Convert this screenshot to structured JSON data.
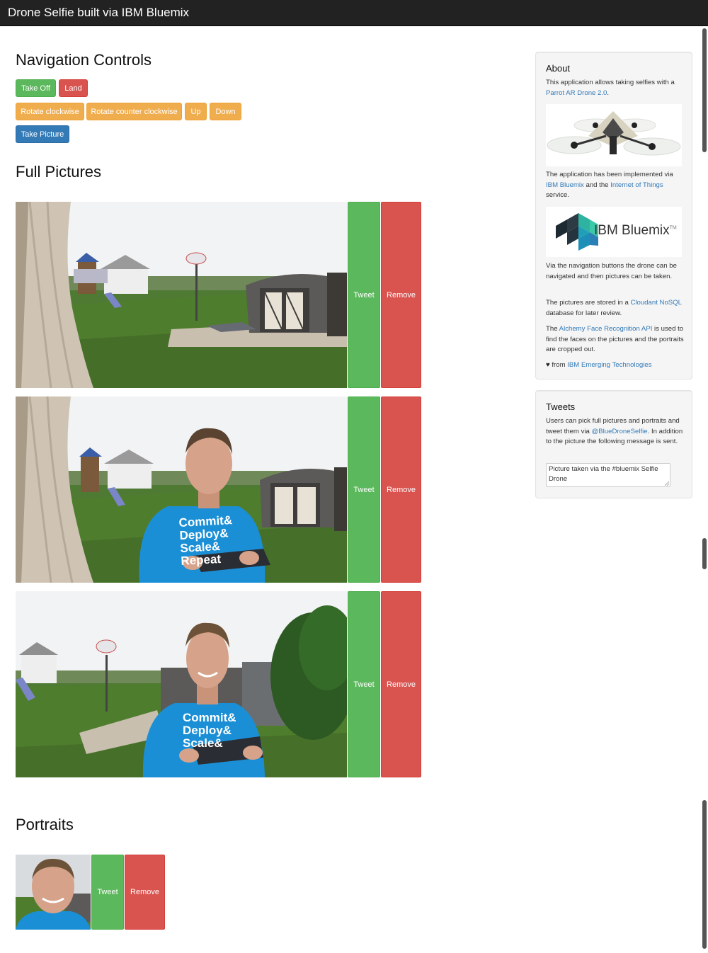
{
  "navbar": {
    "brand": "Drone Selfie built via IBM Bluemix"
  },
  "navigation": {
    "title": "Navigation Controls",
    "buttons": {
      "take_off": "Take Off",
      "land": "Land",
      "rotate_cw": "Rotate clockwise",
      "rotate_ccw": "Rotate counter clockwise",
      "up": "Up",
      "down": "Down",
      "take_picture": "Take Picture"
    }
  },
  "full_pictures": {
    "title": "Full Pictures",
    "items": [
      {
        "tweet": "Tweet",
        "remove": "Remove"
      },
      {
        "tweet": "Tweet",
        "remove": "Remove"
      },
      {
        "tweet": "Tweet",
        "remove": "Remove"
      }
    ]
  },
  "portraits": {
    "title": "Portraits",
    "items": [
      {
        "tweet": "Tweet",
        "remove": "Remove"
      }
    ]
  },
  "photo_shirt_text": [
    "Commit&",
    "Deploy&",
    "Scale&",
    "Repeat"
  ],
  "about": {
    "title": "About",
    "p1_before": "This application allows taking selfies with a ",
    "p1_link": "Parrot AR Drone 2.0",
    "p1_after": ".",
    "p2_before": "The application has been implemented via ",
    "p2_link1": "IBM Bluemix",
    "p2_mid": " and the ",
    "p2_link2": "Internet of Things",
    "p2_after": " service.",
    "logo_text": "IBM Bluemix",
    "logo_tm": "TM",
    "p3": "Via the navigation buttons the drone can be navigated and then pictures can be taken.",
    "p4_before": "The pictures are stored in a ",
    "p4_link": "Cloudant NoSQL",
    "p4_after": " database for later review.",
    "p5_before": "The ",
    "p5_link": "Alchemy Face Recognition API",
    "p5_after": " is used to find the faces on the pictures and the portraits are cropped out.",
    "p6_heart": "♥",
    "p6_before": " from ",
    "p6_link": "IBM Emerging Technologies"
  },
  "tweets": {
    "title": "Tweets",
    "p_before": "Users can pick full pictures and portraits and tweet them via ",
    "p_link": "@BlueDroneSelfie",
    "p_after": ". In addition to the picture the following message is sent.",
    "message": "Picture taken via the #bluemix Selfie Drone"
  },
  "colors": {
    "navbar": "#222222",
    "success": "#5cb85c",
    "danger": "#d9534f",
    "warning": "#f0ad4e",
    "primary": "#337ab7",
    "link": "#337ab7",
    "shirt": "#1b8fd6"
  }
}
